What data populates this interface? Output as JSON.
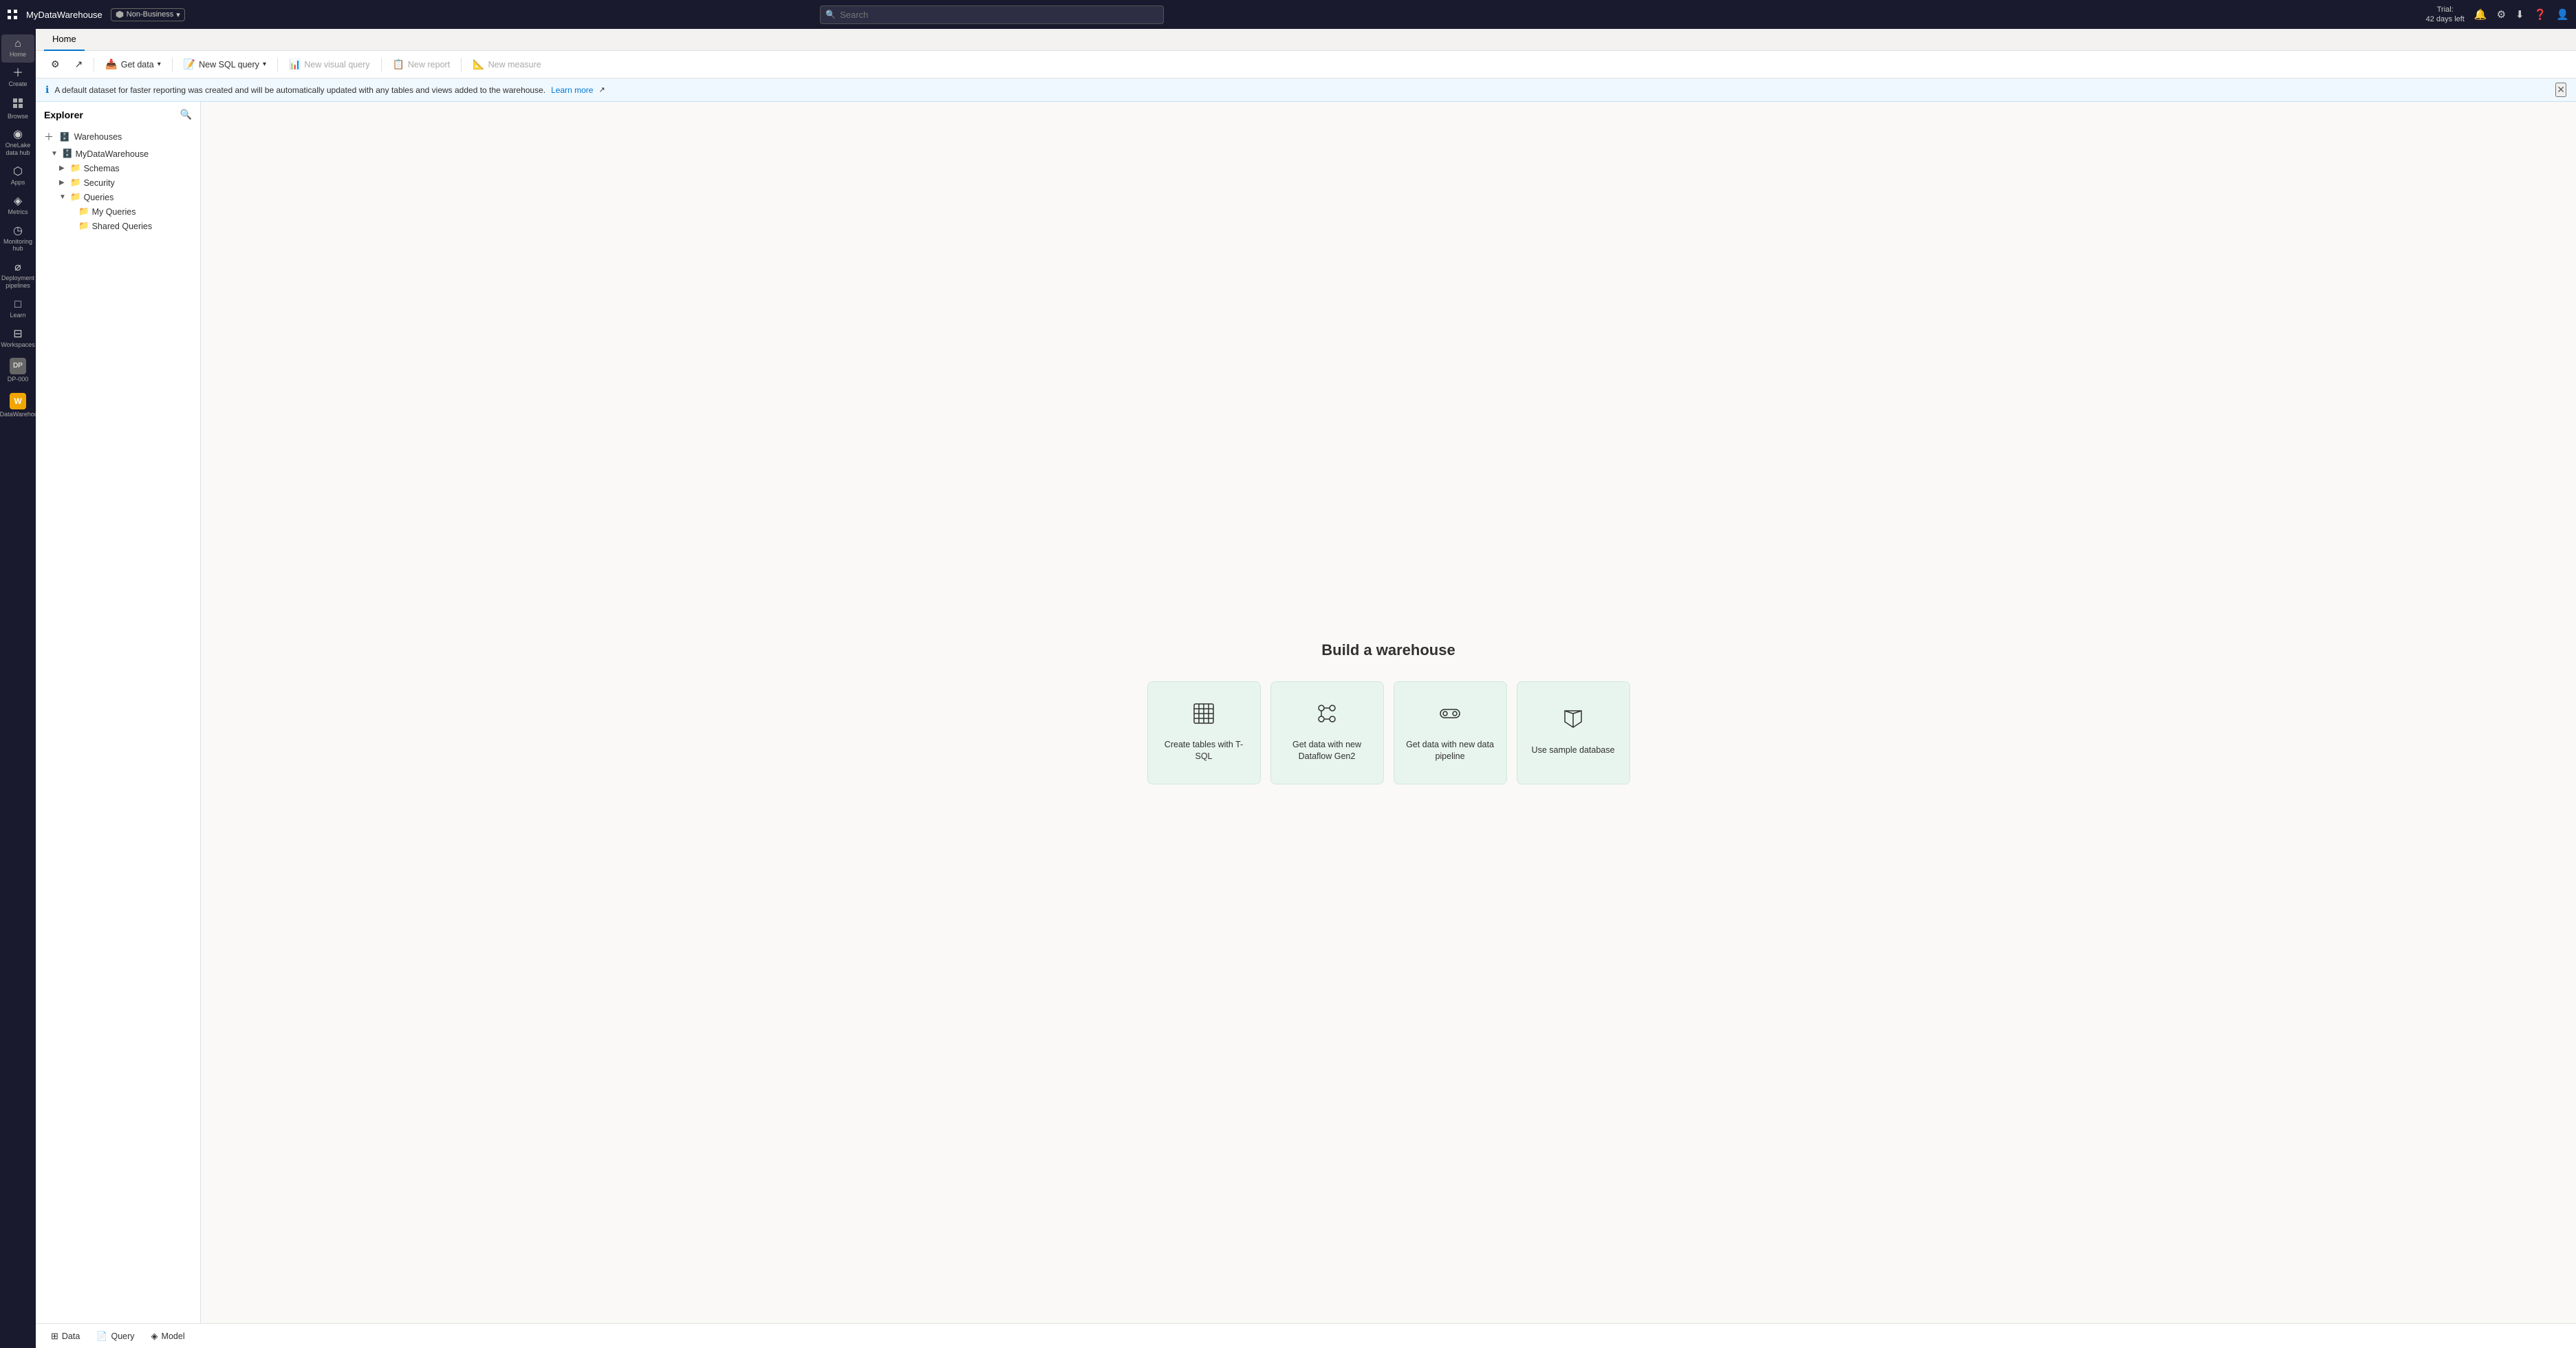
{
  "topbar": {
    "app_title": "MyDataWarehouse",
    "badge_label": "Non-Business",
    "search_placeholder": "Search",
    "trial_line1": "Trial:",
    "trial_line2": "42 days left"
  },
  "nav": {
    "items": [
      {
        "id": "home",
        "icon": "⌂",
        "label": "Home"
      },
      {
        "id": "create",
        "icon": "＋",
        "label": "Create"
      },
      {
        "id": "browse",
        "icon": "⊞",
        "label": "Browse"
      },
      {
        "id": "onelake",
        "icon": "◉",
        "label": "OneLake data hub"
      },
      {
        "id": "apps",
        "icon": "⬡",
        "label": "Apps"
      },
      {
        "id": "metrics",
        "icon": "◈",
        "label": "Metrics"
      },
      {
        "id": "monitoring",
        "icon": "◷",
        "label": "Monitoring hub"
      },
      {
        "id": "deployment",
        "icon": "⌀",
        "label": "Deployment pipelines"
      },
      {
        "id": "learn",
        "icon": "□",
        "label": "Learn"
      },
      {
        "id": "workspaces",
        "icon": "⊟",
        "label": "Workspaces"
      },
      {
        "id": "dp000",
        "icon": "⊕",
        "label": "DP-000"
      },
      {
        "id": "warehouse",
        "icon": "W",
        "label": "MyDataWarehouse"
      }
    ]
  },
  "tabs": [
    {
      "id": "home",
      "label": "Home",
      "active": true
    }
  ],
  "toolbar": {
    "settings_label": "",
    "getdata_label": "Get data",
    "newquery_label": "New SQL query",
    "newvisual_label": "New visual query",
    "newreport_label": "New report",
    "newmeasure_label": "New measure"
  },
  "infobar": {
    "message": "A default dataset for faster reporting was created and will be automatically updated with any tables and views added to the warehouse.",
    "link_label": "Learn more"
  },
  "explorer": {
    "title": "Explorer",
    "add_label": "Warehouses",
    "tree": {
      "warehouse_name": "MyDataWarehouse",
      "schemas_label": "Schemas",
      "security_label": "Security",
      "queries_label": "Queries",
      "my_queries_label": "My Queries",
      "shared_queries_label": "Shared Queries"
    }
  },
  "main": {
    "build_title": "Build a warehouse",
    "cards": [
      {
        "id": "tsql",
        "icon": "⊞",
        "label": "Create tables with T-SQL"
      },
      {
        "id": "dataflow",
        "icon": "⚙",
        "label": "Get data with new Dataflow Gen2"
      },
      {
        "id": "pipeline",
        "icon": "▣",
        "label": "Get data with new data pipeline"
      },
      {
        "id": "sample",
        "icon": "⚑",
        "label": "Use sample database"
      }
    ]
  },
  "bottom_tabs": [
    {
      "id": "data",
      "icon": "⊞",
      "label": "Data"
    },
    {
      "id": "query",
      "icon": "📄",
      "label": "Query"
    },
    {
      "id": "model",
      "icon": "◈",
      "label": "Model"
    }
  ]
}
